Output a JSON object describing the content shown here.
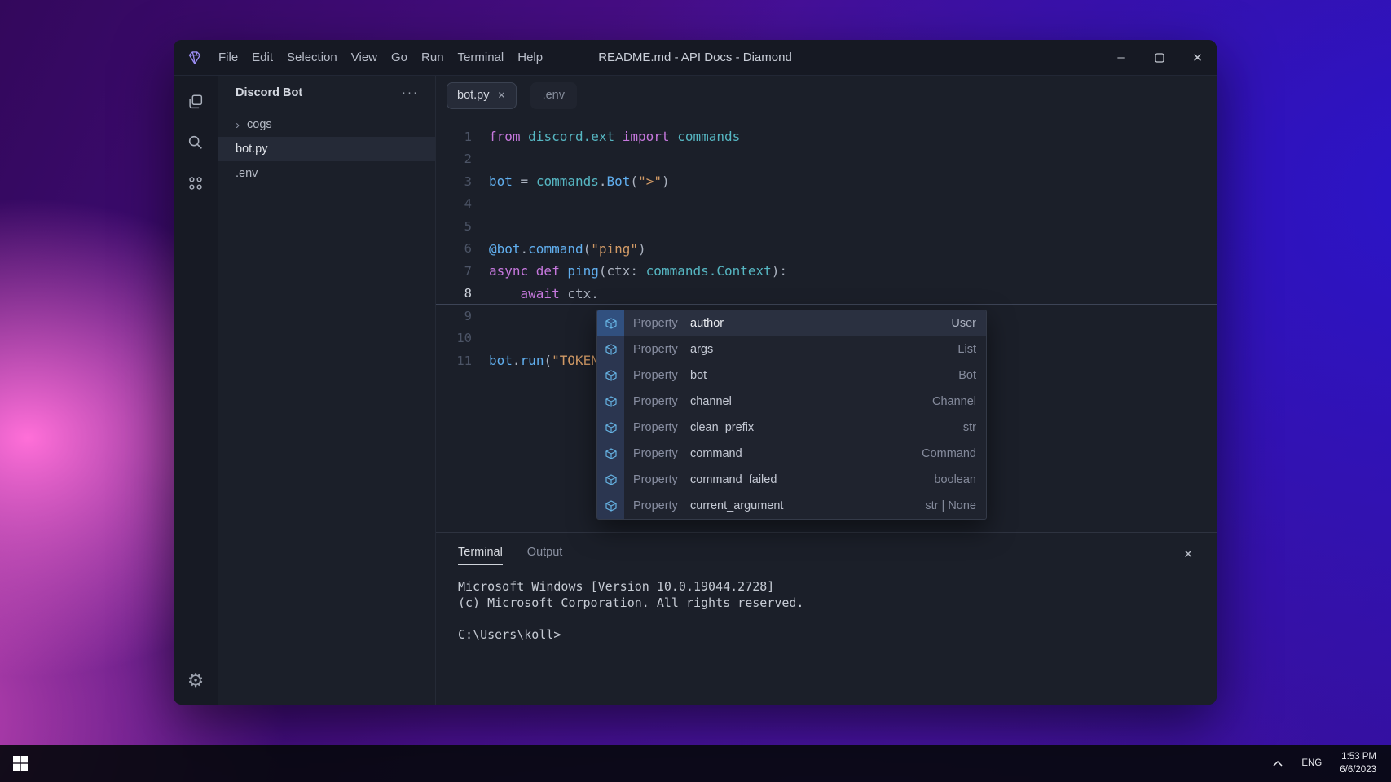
{
  "window": {
    "app_icon": "diamond-gem-icon",
    "title": "README.md - API Docs - Diamond",
    "menu": [
      "File",
      "Edit",
      "Selection",
      "View",
      "Go",
      "Run",
      "Terminal",
      "Help"
    ],
    "controls": {
      "minimize": "–",
      "maximize": "maximize-icon",
      "close": "✕"
    }
  },
  "activity_bar": {
    "icons": [
      "files-icon",
      "search-icon",
      "extensions-icon"
    ],
    "bottom_icon": "settings-gear-icon",
    "gear_glyph": "⚙"
  },
  "sidebar": {
    "header": {
      "title": "Discord Bot",
      "more": "···"
    },
    "items": [
      {
        "label": "cogs",
        "kind": "folder",
        "collapsed": true,
        "chevron": "›",
        "selected": false
      },
      {
        "label": "bot.py",
        "kind": "file",
        "selected": true
      },
      {
        "label": ".env",
        "kind": "file",
        "selected": false
      }
    ]
  },
  "editor": {
    "tabs": [
      {
        "label": "bot.py",
        "active": true,
        "close": "✕"
      },
      {
        "label": ".env",
        "active": false
      }
    ],
    "code_lines": [
      {
        "n": 1,
        "active": false,
        "tokens": [
          {
            "t": "from ",
            "c": "kw"
          },
          {
            "t": "discord.ext ",
            "c": "cls"
          },
          {
            "t": "import ",
            "c": "kw"
          },
          {
            "t": "commands",
            "c": "cls"
          }
        ]
      },
      {
        "n": 2,
        "active": false,
        "tokens": []
      },
      {
        "n": 3,
        "active": false,
        "tokens": [
          {
            "t": "bot",
            "c": "fn"
          },
          {
            "t": " = ",
            "c": "pl"
          },
          {
            "t": "commands",
            "c": "cls"
          },
          {
            "t": ".",
            "c": "pl"
          },
          {
            "t": "Bot",
            "c": "fn"
          },
          {
            "t": "(",
            "c": "pl"
          },
          {
            "t": "\">\"",
            "c": "str"
          },
          {
            "t": ")",
            "c": "pl"
          }
        ]
      },
      {
        "n": 4,
        "active": false,
        "tokens": []
      },
      {
        "n": 5,
        "active": false,
        "tokens": []
      },
      {
        "n": 6,
        "active": false,
        "tokens": [
          {
            "t": "@bot",
            "c": "fn"
          },
          {
            "t": ".",
            "c": "pl"
          },
          {
            "t": "command",
            "c": "fn"
          },
          {
            "t": "(",
            "c": "pl"
          },
          {
            "t": "\"ping\"",
            "c": "str"
          },
          {
            "t": ")",
            "c": "pl"
          }
        ]
      },
      {
        "n": 7,
        "active": false,
        "tokens": [
          {
            "t": "async def ",
            "c": "kw"
          },
          {
            "t": "ping",
            "c": "fn"
          },
          {
            "t": "(",
            "c": "pl"
          },
          {
            "t": "ctx",
            "c": "pl"
          },
          {
            "t": ": ",
            "c": "pl"
          },
          {
            "t": "commands.Context",
            "c": "cls"
          },
          {
            "t": "):",
            "c": "pl"
          }
        ]
      },
      {
        "n": 8,
        "active": true,
        "tokens": [
          {
            "t": "    ",
            "c": "pl"
          },
          {
            "t": "await",
            "c": "kw"
          },
          {
            "t": " ctx.",
            "c": "pl"
          }
        ]
      },
      {
        "n": 9,
        "active": false,
        "tokens": []
      },
      {
        "n": 10,
        "active": false,
        "tokens": []
      },
      {
        "n": 11,
        "active": false,
        "tokens": [
          {
            "t": "bot",
            "c": "fn"
          },
          {
            "t": ".",
            "c": "pl"
          },
          {
            "t": "run",
            "c": "fn"
          },
          {
            "t": "(",
            "c": "pl"
          },
          {
            "t": "\"TOKEN",
            "c": "str"
          }
        ]
      }
    ]
  },
  "autocomplete": {
    "kind_icon": "property-cube-icon",
    "selected_index": 0,
    "items": [
      {
        "kind": "Property",
        "name": "author",
        "type": "User"
      },
      {
        "kind": "Property",
        "name": "args",
        "type": "List"
      },
      {
        "kind": "Property",
        "name": "bot",
        "type": "Bot"
      },
      {
        "kind": "Property",
        "name": "channel",
        "type": "Channel"
      },
      {
        "kind": "Property",
        "name": "clean_prefix",
        "type": "str"
      },
      {
        "kind": "Property",
        "name": "command",
        "type": "Command"
      },
      {
        "kind": "Property",
        "name": "command_failed",
        "type": "boolean"
      },
      {
        "kind": "Property",
        "name": "current_argument",
        "type": "str | None"
      }
    ]
  },
  "terminal": {
    "tabs": [
      {
        "label": "Terminal",
        "active": true
      },
      {
        "label": "Output",
        "active": false
      }
    ],
    "close": "✕",
    "lines": [
      "Microsoft Windows [Version 10.0.19044.2728]",
      "(c) Microsoft Corporation. All rights reserved.",
      "",
      "C:\\Users\\koll>"
    ]
  },
  "taskbar": {
    "start_icon": "windows-start-icon",
    "tray_chevron_icon": "hidden-icons-chevron",
    "language": "ENG",
    "time": "1:53 PM",
    "date": "6/6/2023"
  },
  "colors": {
    "keyword": "#c678dd",
    "string": "#d19a66",
    "class": "#56b6c2",
    "function": "#61afef",
    "plain": "#abb2bf",
    "accent_blue": "#66b3e3",
    "window_bg": "#1b1f29",
    "titlebar_bg": "#161923"
  }
}
